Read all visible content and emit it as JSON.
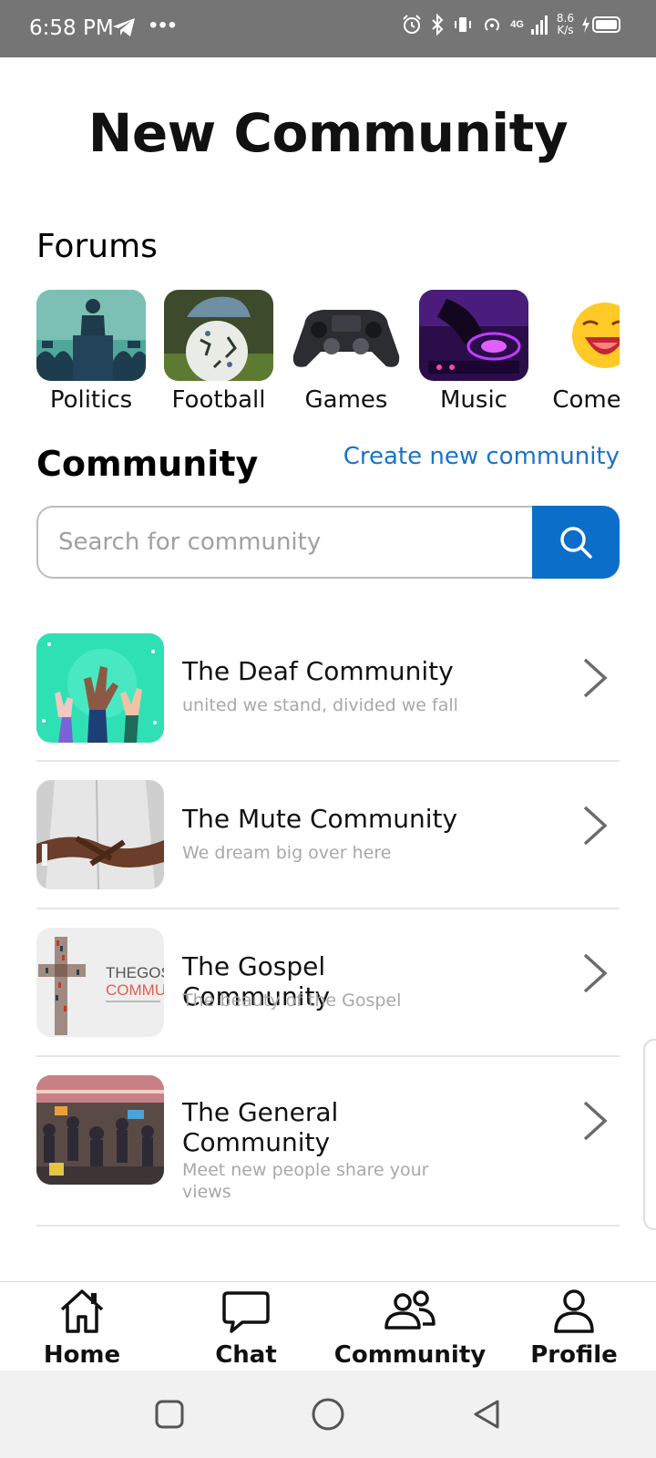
{
  "status_bar": {
    "time": "6:58 PM",
    "dots": "•••",
    "network": "4G",
    "speed_value": "8.6",
    "speed_unit": "K/s"
  },
  "page_title": "New Community",
  "forums": {
    "heading": "Forums",
    "items": [
      {
        "label": "Politics",
        "icon": "politics-thumb"
      },
      {
        "label": "Football",
        "icon": "football-thumb"
      },
      {
        "label": "Games",
        "icon": "gamepad-thumb"
      },
      {
        "label": "Music",
        "icon": "music-thumb"
      },
      {
        "label": "Comedy",
        "icon": "laughing-emoji-thumb"
      }
    ]
  },
  "community": {
    "heading": "Community",
    "create_link": "Create new community",
    "search_placeholder": "Search for community",
    "items": [
      {
        "name": "The Deaf Community",
        "description": "united we stand, divided we fall"
      },
      {
        "name": "The Mute Community",
        "description": "We dream big over here"
      },
      {
        "name": "The Gospel Community",
        "description": "The beauty of the Gospel"
      },
      {
        "name": "The General Community",
        "description": "Meet new people share your views"
      }
    ]
  },
  "gospel_thumb_text": {
    "line1": "THEGOSP",
    "line2": "COMMUNI"
  },
  "bottom_nav": {
    "items": [
      {
        "label": "Home",
        "icon": "home-icon"
      },
      {
        "label": "Chat",
        "icon": "chat-icon"
      },
      {
        "label": "Community",
        "icon": "community-icon"
      },
      {
        "label": "Profile",
        "icon": "profile-icon"
      }
    ]
  },
  "colors": {
    "accent": "#0b6fc9",
    "link": "#1a73c9",
    "status_bar": "#757575"
  }
}
